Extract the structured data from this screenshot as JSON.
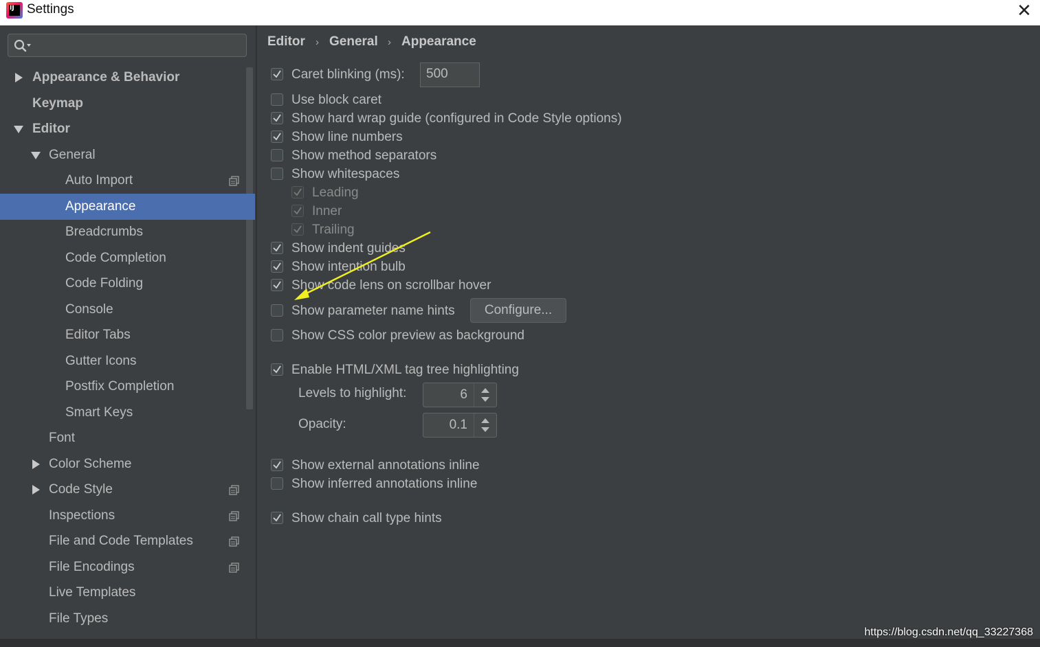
{
  "window": {
    "title": "Settings",
    "app_icon_text": "IJ"
  },
  "sidebar": {
    "search_placeholder": "",
    "items": [
      {
        "label": "Appearance & Behavior",
        "level": 0,
        "bold": true,
        "arrow": "collapsed"
      },
      {
        "label": "Keymap",
        "level": 0,
        "bold": true,
        "arrow": "none"
      },
      {
        "label": "Editor",
        "level": 0,
        "bold": true,
        "arrow": "expanded"
      },
      {
        "label": "General",
        "level": 1,
        "bold": false,
        "arrow": "expanded"
      },
      {
        "label": "Auto Import",
        "level": 2,
        "bold": false,
        "arrow": "none",
        "copy_icon": true
      },
      {
        "label": "Appearance",
        "level": 2,
        "bold": false,
        "arrow": "none",
        "selected": true
      },
      {
        "label": "Breadcrumbs",
        "level": 2,
        "bold": false,
        "arrow": "none"
      },
      {
        "label": "Code Completion",
        "level": 2,
        "bold": false,
        "arrow": "none"
      },
      {
        "label": "Code Folding",
        "level": 2,
        "bold": false,
        "arrow": "none"
      },
      {
        "label": "Console",
        "level": 2,
        "bold": false,
        "arrow": "none"
      },
      {
        "label": "Editor Tabs",
        "level": 2,
        "bold": false,
        "arrow": "none"
      },
      {
        "label": "Gutter Icons",
        "level": 2,
        "bold": false,
        "arrow": "none"
      },
      {
        "label": "Postfix Completion",
        "level": 2,
        "bold": false,
        "arrow": "none"
      },
      {
        "label": "Smart Keys",
        "level": 2,
        "bold": false,
        "arrow": "none"
      },
      {
        "label": "Font",
        "level": 1,
        "bold": false,
        "arrow": "none"
      },
      {
        "label": "Color Scheme",
        "level": 1,
        "bold": false,
        "arrow": "collapsed"
      },
      {
        "label": "Code Style",
        "level": 1,
        "bold": false,
        "arrow": "collapsed",
        "copy_icon": true
      },
      {
        "label": "Inspections",
        "level": 1,
        "bold": false,
        "arrow": "none",
        "copy_icon": true
      },
      {
        "label": "File and Code Templates",
        "level": 1,
        "bold": false,
        "arrow": "none",
        "copy_icon": true
      },
      {
        "label": "File Encodings",
        "level": 1,
        "bold": false,
        "arrow": "none",
        "copy_icon": true
      },
      {
        "label": "Live Templates",
        "level": 1,
        "bold": false,
        "arrow": "none"
      },
      {
        "label": "File Types",
        "level": 1,
        "bold": false,
        "arrow": "none"
      }
    ]
  },
  "breadcrumb": [
    "Editor",
    "General",
    "Appearance"
  ],
  "options": {
    "caret_blinking": {
      "label": "Caret blinking (ms):",
      "checked": true,
      "value": "500"
    },
    "use_block_caret": {
      "label": "Use block caret",
      "checked": false
    },
    "hard_wrap_guide": {
      "label": "Show hard wrap guide (configured in Code Style options)",
      "checked": true
    },
    "line_numbers": {
      "label": "Show line numbers",
      "checked": true
    },
    "method_separators": {
      "label": "Show method separators",
      "checked": false
    },
    "whitespaces": {
      "label": "Show whitespaces",
      "checked": false
    },
    "leading": {
      "label": "Leading",
      "checked": true,
      "disabled": true
    },
    "inner": {
      "label": "Inner",
      "checked": true,
      "disabled": true
    },
    "trailing": {
      "label": "Trailing",
      "checked": true,
      "disabled": true
    },
    "indent_guides": {
      "label": "Show indent guides",
      "checked": true
    },
    "intention_bulb": {
      "label": "Show intention bulb",
      "checked": true
    },
    "code_lens": {
      "label": "Show code lens on scrollbar hover",
      "checked": true
    },
    "param_hints": {
      "label": "Show parameter name hints",
      "checked": false,
      "button": "Configure..."
    },
    "css_color": {
      "label": "Show CSS color preview as background",
      "checked": false
    },
    "tag_tree": {
      "label": "Enable HTML/XML tag tree highlighting",
      "checked": true
    },
    "levels": {
      "label": "Levels to highlight:",
      "value": "6"
    },
    "opacity": {
      "label": "Opacity:",
      "value": "0.1"
    },
    "external_annotations": {
      "label": "Show external annotations inline",
      "checked": true
    },
    "inferred_annotations": {
      "label": "Show inferred annotations inline",
      "checked": false
    },
    "chain_call": {
      "label": "Show chain call type hints",
      "checked": true
    }
  },
  "colors": {
    "background": "#3c3f41",
    "selection": "#4b6eaf",
    "annotation_arrow": "#f0f020"
  },
  "watermark": "https://blog.csdn.net/qq_33227368"
}
